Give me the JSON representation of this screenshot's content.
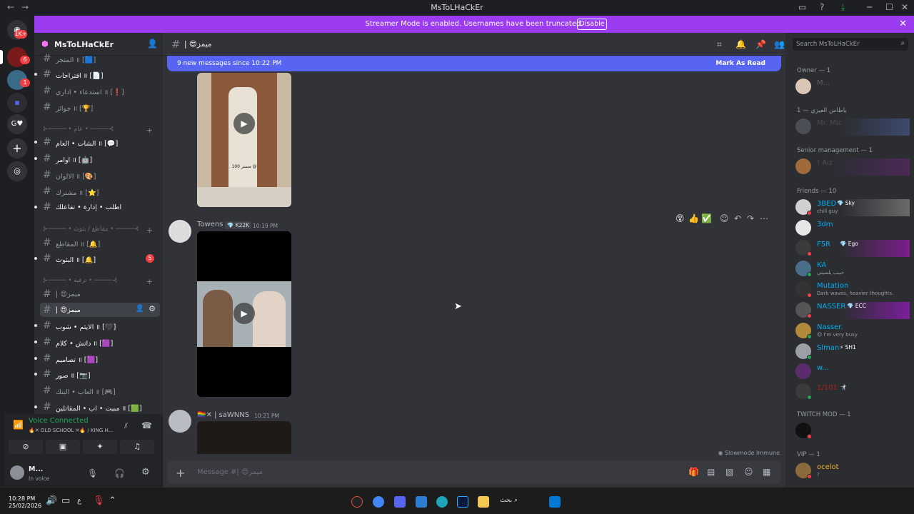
{
  "window": {
    "title": "MsToLHaCkEr",
    "back": "←",
    "forward": "→"
  },
  "banner": {
    "text": "Streamer Mode is enabled. Usernames have been truncated.",
    "button": "Disable",
    "close": "✕"
  },
  "rail": {
    "home_badge": "1K+",
    "badge_a": "6",
    "badge_b": "1",
    "g_label": "G♥"
  },
  "server": {
    "name": "MsToLHaCkEr"
  },
  "channels": [
    {
      "name": "المتجر ॥ [🟦]",
      "bright": false,
      "arrow": false
    },
    {
      "name": "اقتراحات ॥ [📄]",
      "bright": true,
      "arrow": true
    },
    {
      "name": "استدعاء • اداري ॥ [❗]",
      "bright": false,
      "arrow": false
    },
    {
      "name": "جوائز ॥ [🏆]",
      "bright": false,
      "arrow": false
    }
  ],
  "category_1": "⊱───── • عام • ─────⊰",
  "channels_2": [
    {
      "name": "الشات • العام ॥ [💬]",
      "bright": true,
      "arrow": true
    },
    {
      "name": "اوامر ॥ [🤖]",
      "bright": true,
      "arrow": true
    },
    {
      "name": "الالوان ॥ [🎨]",
      "bright": false,
      "arrow": false
    },
    {
      "name": "مشترك ॥ [⭐]",
      "bright": false,
      "arrow": false
    },
    {
      "name": "اطلب • إدارة • تفاعلك",
      "bright": true,
      "arrow": true
    }
  ],
  "category_2": "⊱───── • مقاطع / بثوث • ─────⊰",
  "channels_3": [
    {
      "name": "المقاطع ॥ [🔔]",
      "bright": false,
      "arrow": false
    },
    {
      "name": "البثوث ॥ [🔔]",
      "bright": true,
      "arrow": true,
      "mention": "5"
    }
  ],
  "category_3": "⊱───── • ترفية • ─────⊰",
  "channels_4": [
    {
      "name": "| 😍ميمز",
      "bright": false,
      "arrow": false
    },
    {
      "name": "| 😍ميمز",
      "bright": true,
      "arrow": true,
      "active": true
    },
    {
      "name": "الايثم • شوب ॥ [🖤]",
      "bright": true,
      "arrow": true
    },
    {
      "name": "داتش • كلام ॥ [🟪]",
      "bright": true,
      "arrow": true
    },
    {
      "name": "تصاميم ॥ [🟪]",
      "bright": true,
      "arrow": true
    },
    {
      "name": "صور ॥ [📷]",
      "bright": true,
      "arrow": true
    },
    {
      "name": "العاب • البنك ॥ [🎮]",
      "bright": false,
      "arrow": false
    },
    {
      "name": "مبيت • اب • المقاتلين ॥ [🟩]",
      "bright": true,
      "arrow": true
    }
  ],
  "voice": {
    "status": "Voice Connected",
    "channel": "🔥✕ OLD SCHOOL ✕🔥 / KING H...",
    "user": "M...",
    "user_status": "In voice"
  },
  "chat": {
    "channel_title": "| 😍ميمز",
    "new_messages": "9 new messages since 10:22 PM",
    "mark_read": "Mark As Read",
    "messages": [
      {
        "author": "Towens",
        "tag": "💎 K22K",
        "time": "10:19 PM"
      },
      {
        "author": "🏳️‍🌈✕ | saWNNS",
        "tag": "",
        "time": "10:21 PM"
      }
    ],
    "video_caption_1": "مستر 100 @",
    "reactions": [
      "😵",
      "👍",
      "✅"
    ],
    "slowmode": "Slowmode Immune",
    "composer_placeholder": "Message #| 😍ميمز"
  },
  "members": {
    "search_placeholder": "Search MsToLHaCkEr",
    "categories": {
      "owner": "Owner — 1",
      "arabic": "ياطاس العيزي — 1",
      "senior": "Senior management — 1",
      "friends": "Friends — 10",
      "twitch": "TWITCH MOD — 1",
      "vip": "VIP — 1"
    },
    "owner_list": [
      {
        "name": "M..."
      }
    ],
    "arabic_list": [
      {
        "name": "Mr. Mic"
      }
    ],
    "senior_list": [
      {
        "name": "! Aiz"
      }
    ],
    "friends_list": [
      {
        "name": "3BED",
        "badge": "💎 Sky",
        "sub": "chill guy"
      },
      {
        "name": "3dm",
        "badge": "",
        "sub": ""
      },
      {
        "name": "F5R",
        "badge": "💎 Ego",
        "sub": ""
      },
      {
        "name": "KA",
        "badge": "",
        "sub": "حبيب يلصيني"
      },
      {
        "name": "Mutation",
        "badge": "",
        "sub": "Dark waves, heavier thoughts."
      },
      {
        "name": "NASSER",
        "badge": "💎 ECC",
        "sub": ""
      },
      {
        "name": "Nasser.",
        "badge": "",
        "sub": "😞 I'm very busy"
      },
      {
        "name": "Slman",
        "badge": "⚡ SH1",
        "sub": ""
      },
      {
        "name": "w...",
        "badge": "",
        "sub": ""
      },
      {
        "name": "1/101",
        "badge": "🤺",
        "sub": ""
      }
    ],
    "twitch_list": [
      {
        "name": ""
      }
    ],
    "vip_list": [
      {
        "name": "ocelot",
        "sub": "?"
      }
    ]
  },
  "taskbar": {
    "time": "10:28 PM",
    "date": "25/02/2026",
    "lang": "ع",
    "search": "بحث"
  },
  "colors": {
    "banner": "#9b3cf0",
    "new_bar": "#5865f2",
    "voice_green": "#23a55a",
    "mention_red": "#f23f43"
  }
}
